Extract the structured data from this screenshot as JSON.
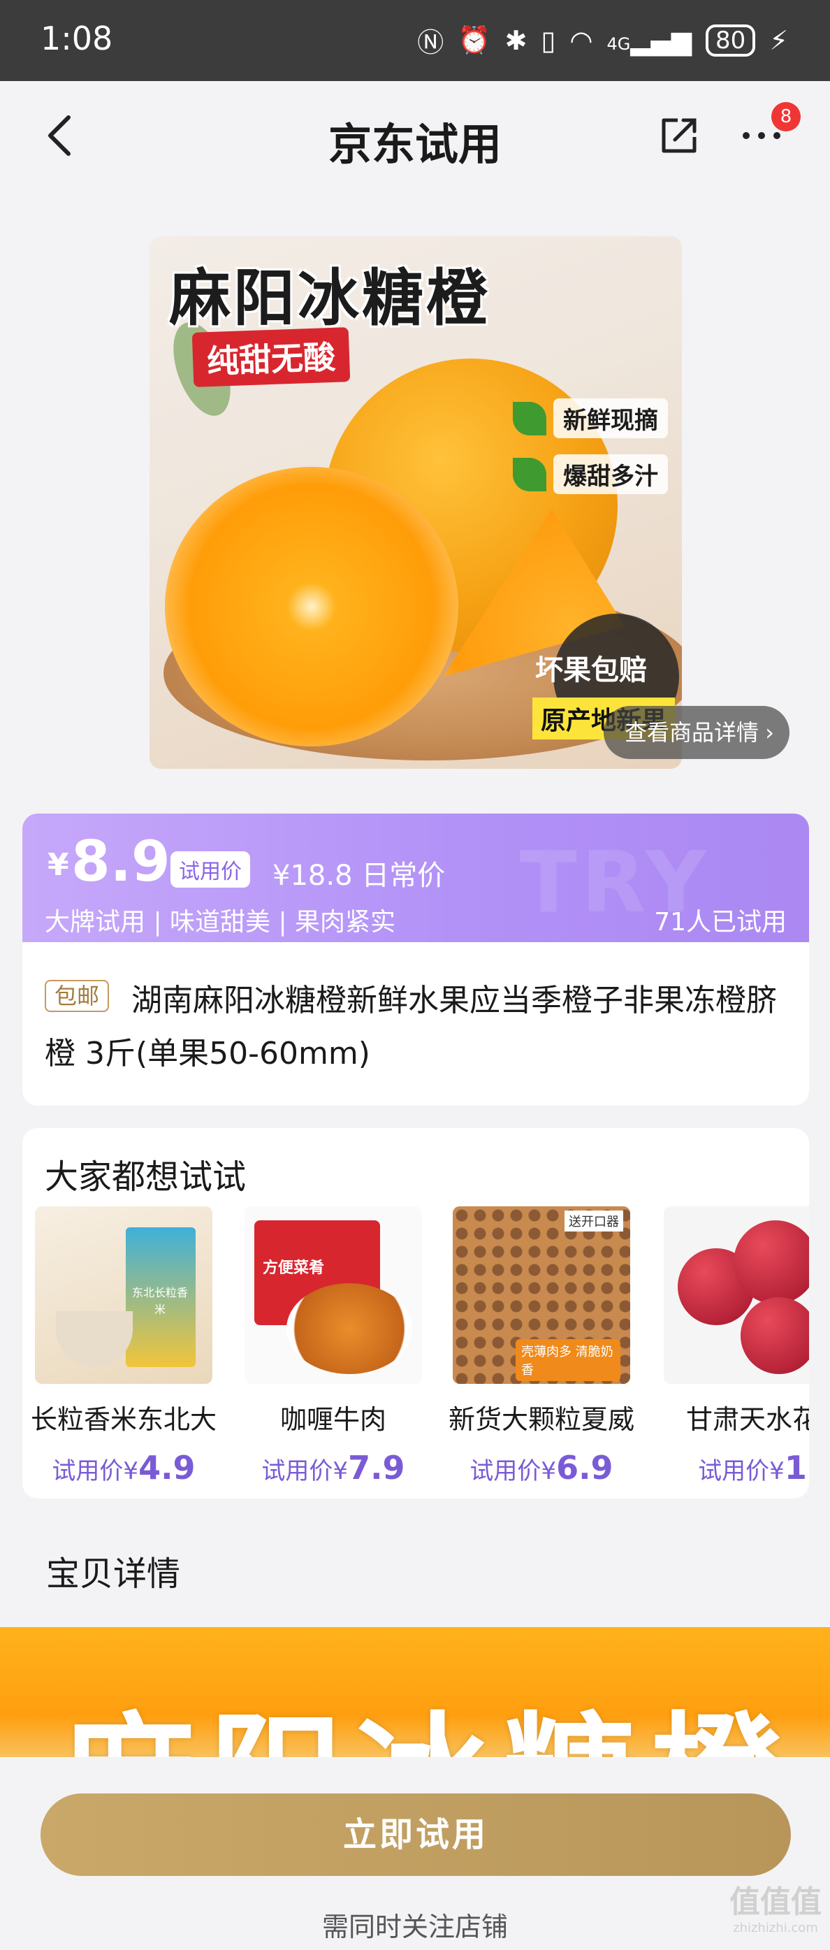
{
  "status_bar": {
    "time": "1:08",
    "signal": "4G",
    "battery": "80"
  },
  "nav": {
    "title": "京东试用",
    "badge_count": "8"
  },
  "hero": {
    "title": "麻阳冰糖橙",
    "subtitle": "纯甜无酸",
    "tag_1": "新鲜现摘",
    "tag_2": "爆甜多汁",
    "badge": "坏果包赔",
    "origin": "原产地新果",
    "view_detail": "查看商品详情"
  },
  "price": {
    "currency": "¥",
    "trial_price": "8.9",
    "trial_label": "试用价",
    "original": "¥18.8 日常价",
    "features": "大牌试用 | 味道甜美 | 果肉紧实",
    "tried_count": "71人已试用",
    "watermark": "TRY"
  },
  "product": {
    "shipping_tag": "包邮",
    "title": "湖南麻阳冰糖橙新鲜水果应当季橙子非果冻橙脐橙 3斤(单果50-60mm)"
  },
  "recommend": {
    "title": "大家都想试试",
    "items": [
      {
        "name": "长粒香米东北大",
        "price_label": "试用价¥",
        "price": "4.9"
      },
      {
        "name": "咖喱牛肉",
        "price_label": "试用价¥",
        "price": "7.9"
      },
      {
        "name": "新货大颗粒夏威",
        "price_label": "试用价¥",
        "price": "6.9"
      },
      {
        "name": "甘肃天水花",
        "price_label": "试用价¥",
        "price": "1"
      }
    ],
    "item_1_pack_text": "东北长粒香米",
    "item_2_pack_text": "方便菜肴",
    "item_3_pack_text_a": "送开口器",
    "item_3_pack_text_b": "壳薄肉多 清脆奶香"
  },
  "details": {
    "heading": "宝贝详情",
    "banner_text": "麻阳冰糖橙"
  },
  "bottom": {
    "cta": "立即试用",
    "note": "需同时关注店铺"
  },
  "watermark": {
    "main": "值值值",
    "sub": "zhizhizhi.com"
  },
  "colors": {
    "accent_purple": "#b292f7",
    "cta_gold": "#b8965a",
    "badge_red": "#f03535"
  }
}
